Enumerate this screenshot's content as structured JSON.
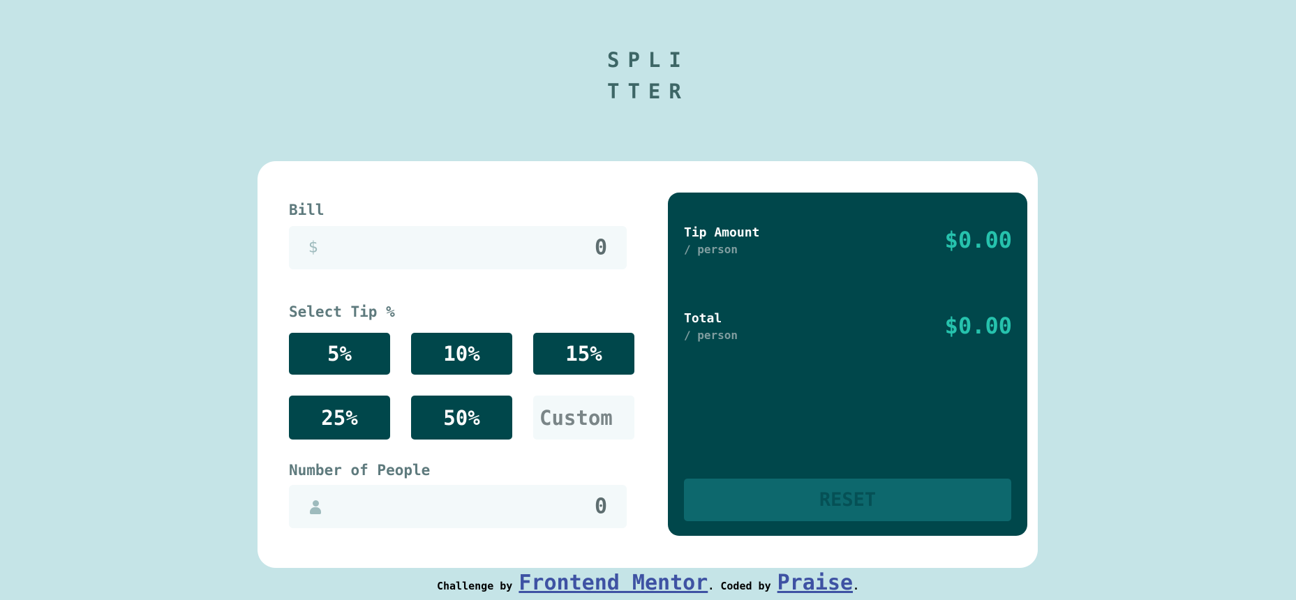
{
  "logo": {
    "line1": "SPLI",
    "line2": "TTER"
  },
  "calculator": {
    "bill": {
      "label": "Bill",
      "icon": "dollar-icon",
      "icon_glyph": "$",
      "value": "0"
    },
    "tip": {
      "label": "Select Tip %",
      "options": [
        "5%",
        "10%",
        "15%",
        "25%",
        "50%"
      ],
      "custom_placeholder": "Custom"
    },
    "people": {
      "label": "Number of People",
      "icon": "person-icon",
      "value": "0"
    }
  },
  "results": {
    "tip_amount": {
      "title": "Tip Amount",
      "sub": "/ person",
      "value": "$0.00"
    },
    "total": {
      "title": "Total",
      "sub": "/ person",
      "value": "$0.00"
    },
    "reset_label": "RESET"
  },
  "attribution": {
    "prefix": "Challenge by ",
    "link1": "Frontend Mentor",
    "middle": ". Coded by ",
    "link2": "Praise",
    "suffix": "."
  },
  "colors": {
    "background": "#c5e4e7",
    "card": "#ffffff",
    "dark_cyan": "#00474b",
    "accent": "#26c2ad",
    "input_bg": "#f3f9fa"
  }
}
